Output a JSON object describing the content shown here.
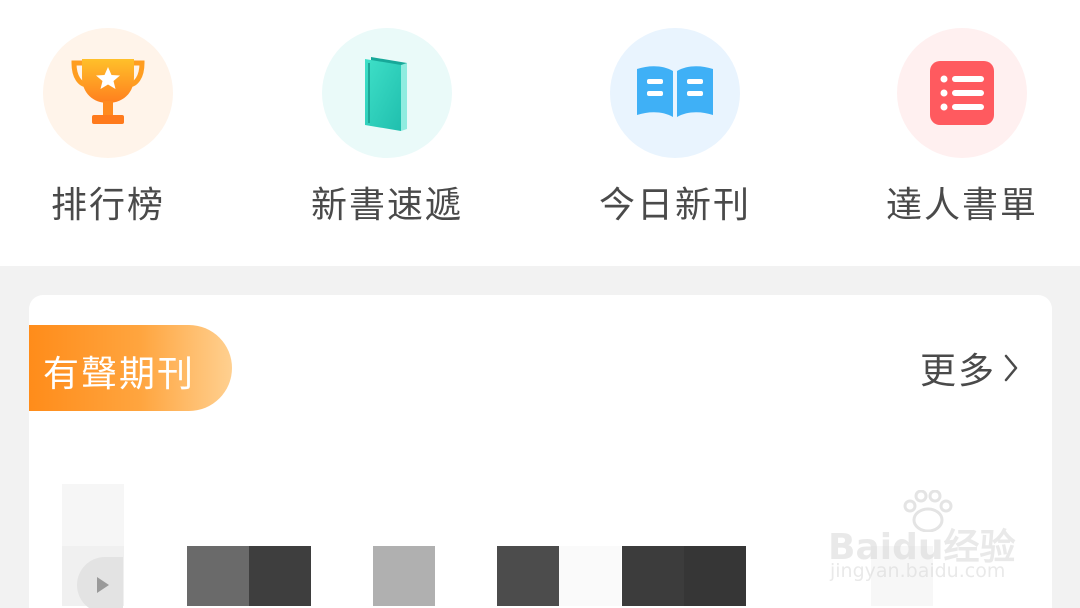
{
  "quick_menu": {
    "items": [
      {
        "label": "排行榜",
        "icon": "trophy-icon",
        "color": "#ff9a1f"
      },
      {
        "label": "新書速遞",
        "icon": "book-icon",
        "color": "#2fd3c0"
      },
      {
        "label": "今日新刊",
        "icon": "open-book-icon",
        "color": "#4ab3f7"
      },
      {
        "label": "達人書單",
        "icon": "list-icon",
        "color": "#ff5a5f"
      }
    ]
  },
  "section": {
    "title": "有聲期刊",
    "more_label": "更多",
    "more_icon": "chevron-right-icon",
    "accent": "#ff8c1a"
  },
  "watermark": {
    "brand": "Baidu经验",
    "url": "jingyan.baidu.com"
  }
}
